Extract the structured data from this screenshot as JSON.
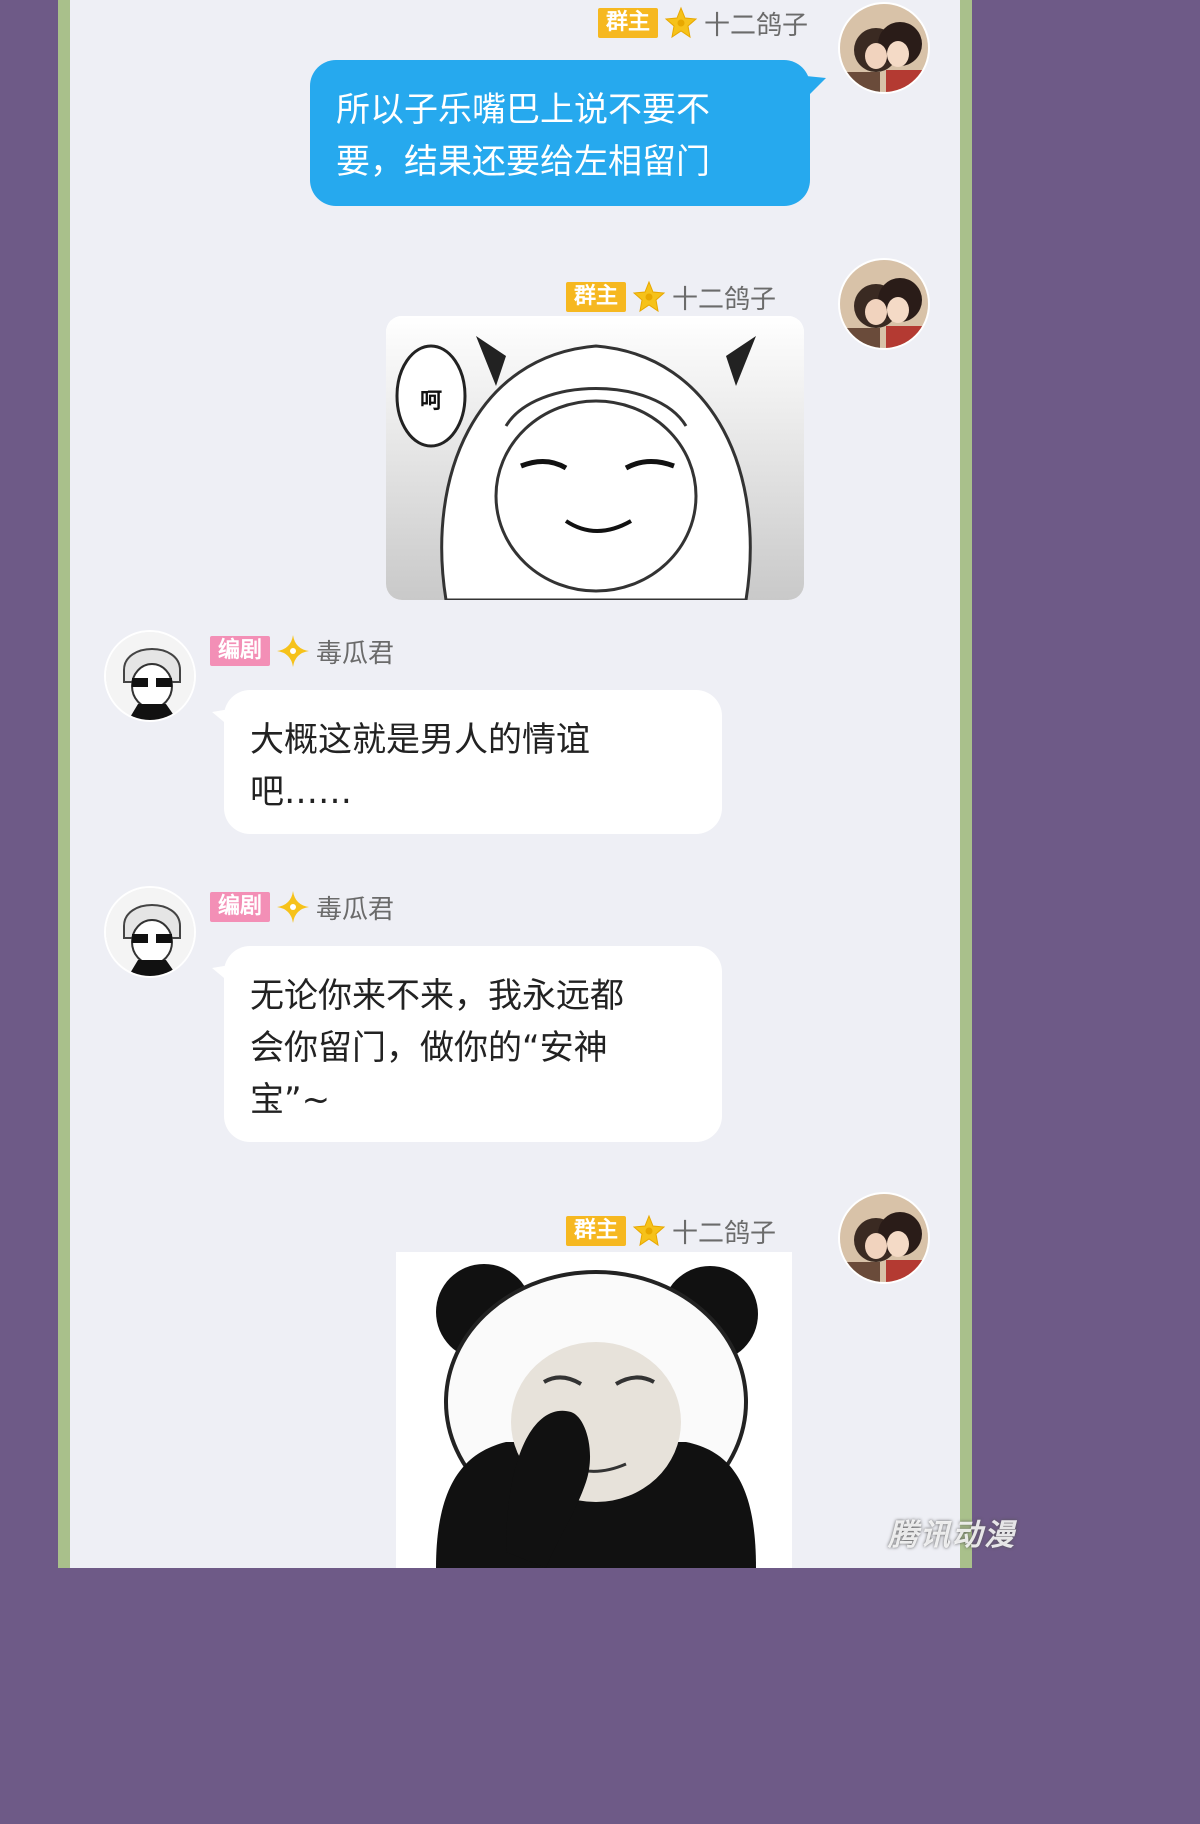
{
  "messages": [
    {
      "role_badge": "群主",
      "username": "十二鸽子",
      "text": "所以子乐嘴巴上说不要不\n要，结果还要给左相留门"
    },
    {
      "role_badge": "群主",
      "username": "十二鸽子",
      "sticker_text": "呵"
    },
    {
      "role_badge": "编剧",
      "username": "毒瓜君",
      "text": "大概这就是男人的情谊\n吧……"
    },
    {
      "role_badge": "编剧",
      "username": "毒瓜君",
      "text": "无论你来不来，我永远都\n会你留门，做你的“安神\n宝”~"
    },
    {
      "role_badge": "群主",
      "username": "十二鸽子"
    }
  ],
  "watermark": "腾讯动漫",
  "colors": {
    "background": "#6e5a87",
    "frame_border": "#a9c08b",
    "panel": "#eeeff5",
    "owner_badge": "#f6b820",
    "writer_badge": "#f38fb6",
    "sent_bubble": "#26a9ee",
    "received_bubble": "#ffffff"
  }
}
